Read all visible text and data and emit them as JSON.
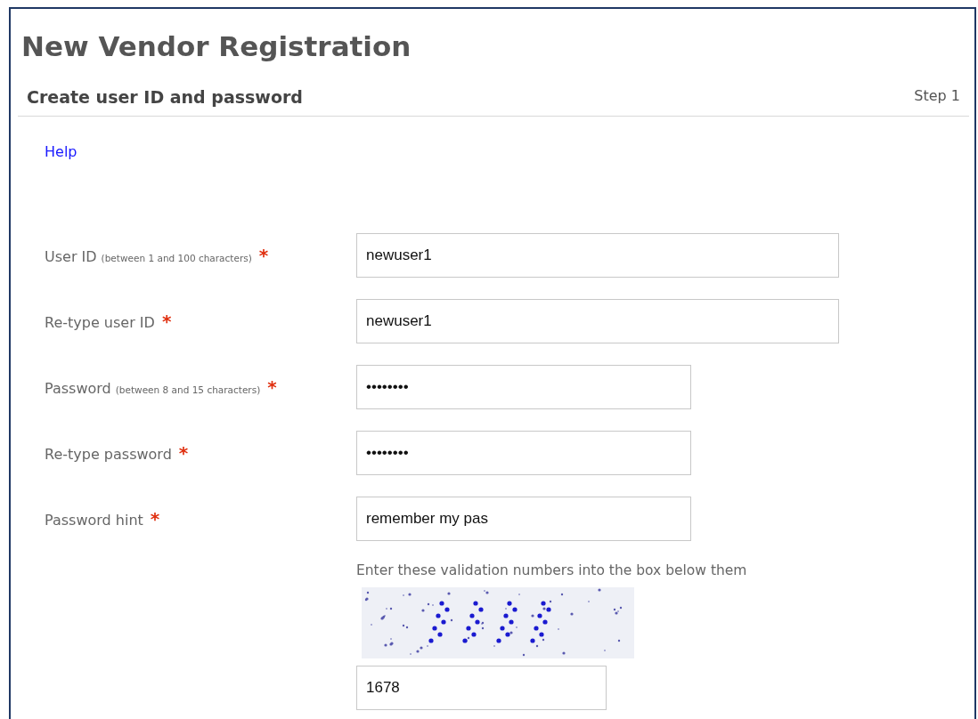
{
  "page": {
    "title": "New Vendor Registration"
  },
  "section": {
    "title": "Create user ID and password",
    "step": "Step 1"
  },
  "help_link": "Help",
  "fields": [
    {
      "label": "User ID",
      "note": "(between 1 and 100 characters)",
      "required_mark": "*",
      "value": "newuser1"
    },
    {
      "label": "Re-type user ID",
      "required_mark": "*",
      "value": "newuser1"
    },
    {
      "label": "Password",
      "note": "(between 8 and 15 characters)",
      "required_mark": "*",
      "value": "••••••••"
    },
    {
      "label": "Re-type password",
      "required_mark": "*",
      "value": "••••••••"
    },
    {
      "label": "Password hint",
      "required_mark": "*",
      "value": "remember my pas"
    }
  ],
  "validation": {
    "instruction": "Enter these validation numbers into the box below them",
    "value": "1678"
  }
}
